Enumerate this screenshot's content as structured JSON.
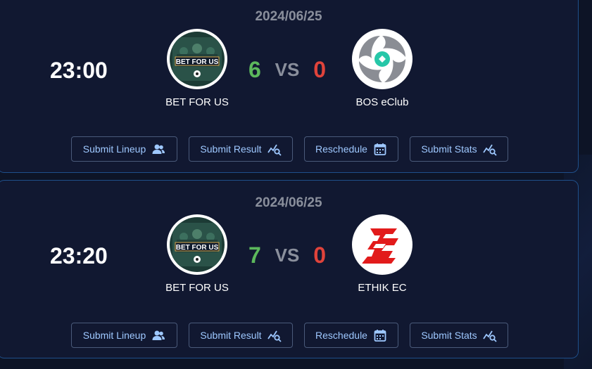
{
  "matches": [
    {
      "date": "2024/06/25",
      "time": "23:00",
      "home": {
        "name": "BET FOR US",
        "logo_icon": "bet-for-us-logo"
      },
      "away": {
        "name": "BOS eClub",
        "logo_icon": "bos-eclub-logo"
      },
      "score_home": "6",
      "score_vs": "VS",
      "score_away": "0",
      "actions": {
        "lineup": "Submit Lineup",
        "result": "Submit Result",
        "reschedule": "Reschedule",
        "stats": "Submit Stats"
      }
    },
    {
      "date": "2024/06/25",
      "time": "23:20",
      "home": {
        "name": "BET FOR US",
        "logo_icon": "bet-for-us-logo"
      },
      "away": {
        "name": "ETHIK EC",
        "logo_icon": "ethik-ec-logo"
      },
      "score_home": "7",
      "score_vs": "VS",
      "score_away": "0",
      "actions": {
        "lineup": "Submit Lineup",
        "result": "Submit Result",
        "reschedule": "Reschedule",
        "stats": "Submit Stats"
      }
    }
  ],
  "colors": {
    "win": "#5cb85c",
    "loss": "#e0433b",
    "vs": "#8a8f9c",
    "button_text": "#9ec8ff",
    "card_border": "#1f4f8a"
  }
}
